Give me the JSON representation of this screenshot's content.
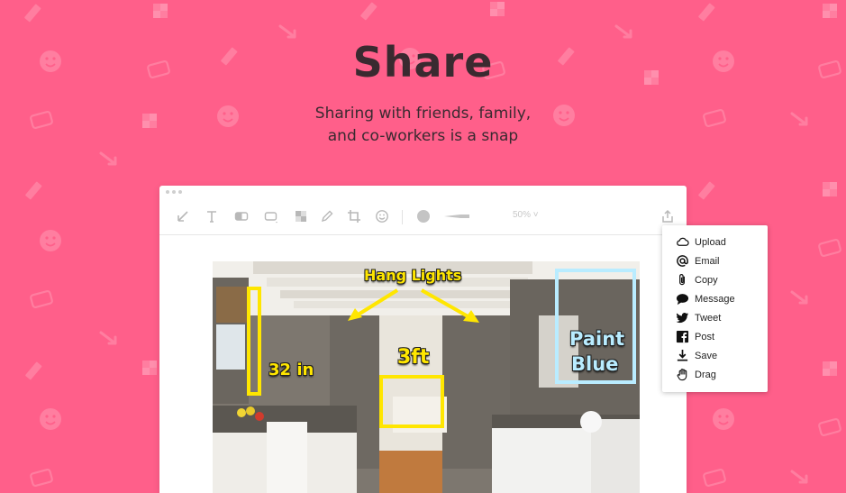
{
  "hero": {
    "title": "Share",
    "subtitle_line1": "Sharing with friends, family,",
    "subtitle_line2": "and co-workers is a snap"
  },
  "colors": {
    "background": "#ff5f8a",
    "pattern": "#ff7ea0",
    "title_text": "#3a2a30",
    "annotation_yellow": "#ffe600",
    "annotation_blue": "#b9ecff"
  },
  "toolbar": {
    "tools": [
      "arrow-icon",
      "text-icon",
      "highlight-icon",
      "rectangle-icon",
      "pixelate-icon",
      "pencil-icon",
      "crop-icon",
      "emoji-icon",
      "color-icon",
      "line-width-icon"
    ],
    "zoom_label": "50% ˅",
    "share_icon": "share-icon"
  },
  "annotations": {
    "hang_lights": "Hang Lights",
    "three_ft": "3ft",
    "thirty_two_in": "32 in",
    "paint_line1": "Paint",
    "paint_line2": "Blue"
  },
  "share_menu": {
    "items": [
      {
        "label": "Upload",
        "icon": "cloud-icon"
      },
      {
        "label": "Email",
        "icon": "at-icon"
      },
      {
        "label": "Copy",
        "icon": "paperclip-icon"
      },
      {
        "label": "Message",
        "icon": "speech-bubble-icon"
      },
      {
        "label": "Tweet",
        "icon": "twitter-icon"
      },
      {
        "label": "Post",
        "icon": "facebook-icon"
      },
      {
        "label": "Save",
        "icon": "download-icon"
      },
      {
        "label": "Drag",
        "icon": "hand-icon"
      }
    ]
  }
}
